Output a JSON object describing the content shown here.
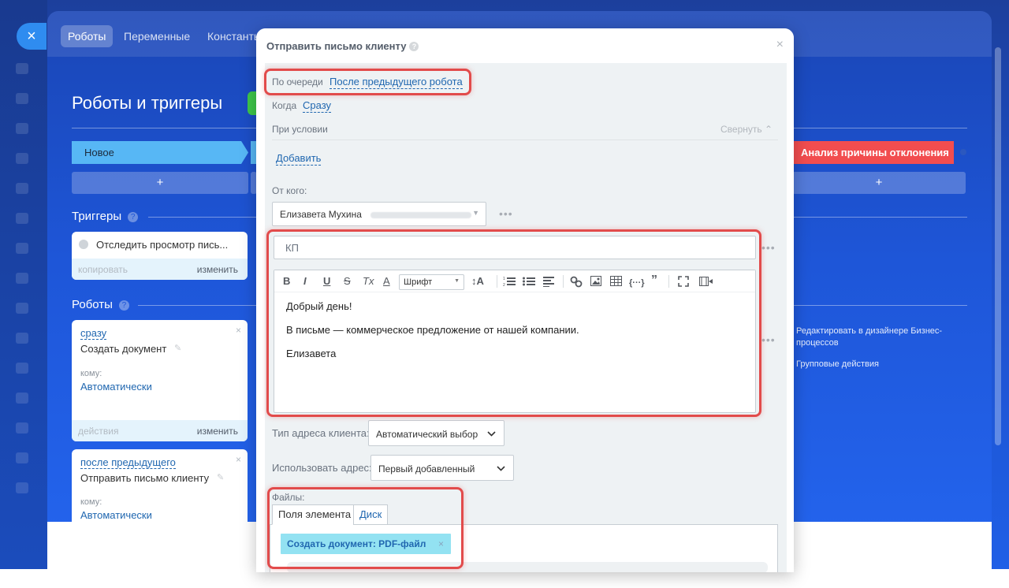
{
  "top_nav": {
    "close_icon": "×",
    "tabs": [
      "Роботы",
      "Переменные",
      "Константы"
    ]
  },
  "page": {
    "title": "Роботы и триггеры",
    "stages": [
      "Новое",
      "Анализ причины отклонения"
    ],
    "plus": "+",
    "triggers_title": "Триггеры",
    "robots_title": "Роботы",
    "help": "?"
  },
  "trigger_card": {
    "text": "Отследить просмотр пись...",
    "copy": "копировать",
    "edit": "изменить"
  },
  "robot_cards": [
    {
      "when": "сразу",
      "name": "Создать документ",
      "to_label": "кому:",
      "to_value": "Автоматически",
      "actions": "действия",
      "edit": "изменить"
    },
    {
      "when": "после предыдущего",
      "name": "Отправить письмо клиенту",
      "to_label": "кому:",
      "to_value": "Автоматически"
    }
  ],
  "right_panel": {
    "designer_link": "Редактировать в дизайнере Бизнес-процессов",
    "group_actions": "Групповые действия"
  },
  "modal": {
    "title": "Отправить письмо клиенту",
    "help": "?",
    "close": "×",
    "order_label": "По очереди",
    "order_value": "После предыдущего робота",
    "when_label": "Когда",
    "when_value": "Сразу",
    "condition_label": "При условии",
    "collapse": "Свернуть",
    "add_link": "Добавить",
    "from_label": "От кого:",
    "from_value": "Елизавета Мухина",
    "more": "•••",
    "subject": "КП",
    "toolbar": {
      "bold": "B",
      "italic": "I",
      "underline": "U",
      "strike": "S",
      "clear": "Tx",
      "color": "A",
      "font": "Шрифт",
      "font_size": "↕A"
    },
    "body_lines": [
      "Добрый день!",
      "В письме — коммерческое предложение от нашей компании.",
      "Елизавета"
    ],
    "address_type_label": "Тип адреса клиента:",
    "address_type_value": "Автоматический выбор",
    "use_address_label": "Использовать адрес:",
    "use_address_value": "Первый добавленный",
    "files_label": "Файлы:",
    "file_tabs": [
      "Поля элемента",
      "Диск"
    ],
    "file_chip": "Создать документ: PDF-файл",
    "chip_remove": "×"
  },
  "colors": {
    "accent": "#2067b0",
    "highlight": "#e24b4b",
    "stage_new": "#57b7f5",
    "stage_reject": "#f24d4f",
    "file_chip": "#93e2f2"
  }
}
